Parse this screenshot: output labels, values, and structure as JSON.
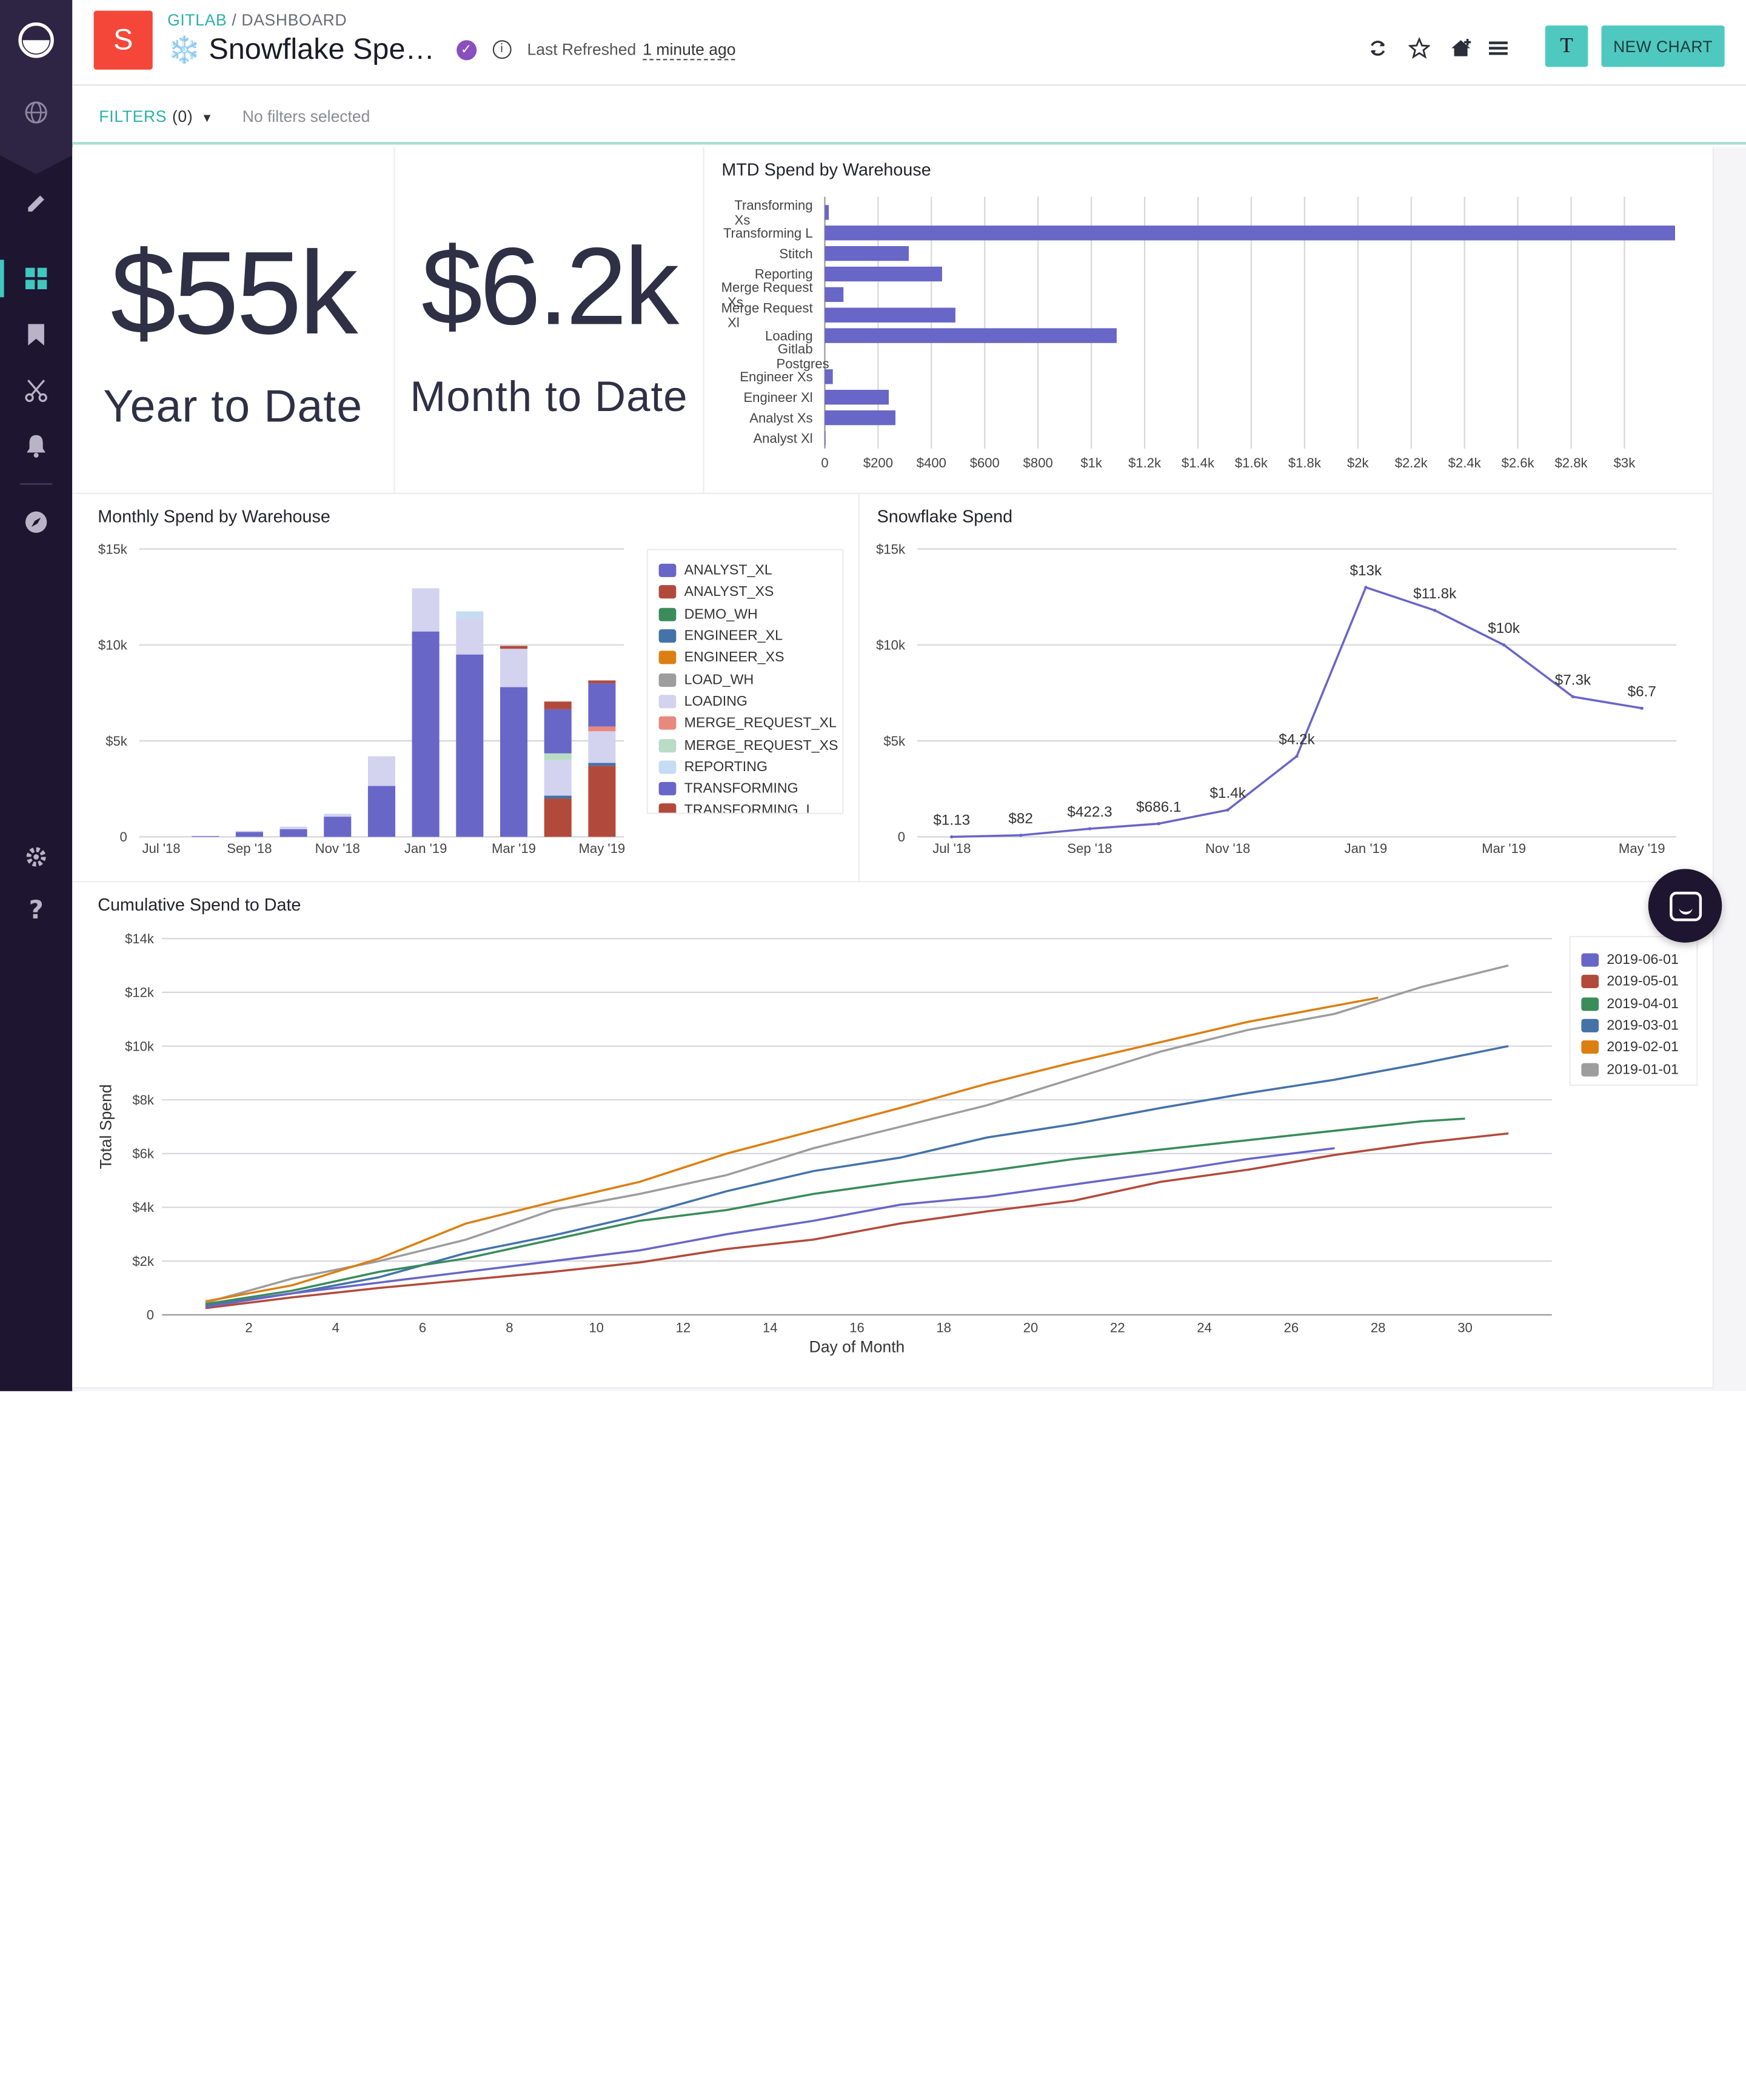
{
  "app": {
    "badge_letter": "S",
    "breadcrumb_org": "GITLAB",
    "breadcrumb_sep": " / ",
    "breadcrumb_page": "DASHBOARD",
    "title_emoji": "❄️",
    "title": "Snowflake Spe…",
    "refreshed_label": "Last Refreshed",
    "refreshed_value": "1 minute ago",
    "user_initial": "T",
    "new_chart_label": "NEW CHART"
  },
  "filters": {
    "label": "FILTERS",
    "count": "(0)",
    "empty_text": "No filters selected"
  },
  "colors": {
    "accent": "#4fc9c0",
    "sidebar": "#1e1530",
    "primary_series": "#6866c7"
  },
  "sidebar_icons": [
    "logo-icon",
    "globe-icon",
    "pencil-icon",
    "dashboard-icon",
    "bookmark-icon",
    "scissors-icon",
    "bell-icon",
    "compass-icon",
    "gear-icon",
    "help-icon"
  ],
  "kpis": [
    {
      "value": "$55k",
      "label": "Year to Date"
    },
    {
      "value": "$6.2k",
      "label": "Month to Date"
    }
  ],
  "charts": {
    "mtd": {
      "title": "MTD Spend by Warehouse",
      "type": "hbar",
      "categories": [
        "Transforming Xs",
        "Transforming L",
        "Stitch",
        "Reporting",
        "Merge Request Xs",
        "Merge Request Xl",
        "Loading",
        "Gitlab Postgres",
        "Engineer Xs",
        "Engineer Xl",
        "Analyst Xs",
        "Analyst Xl"
      ],
      "values": [
        15,
        3190,
        315,
        440,
        70,
        490,
        1095,
        0,
        30,
        240,
        265,
        3
      ],
      "xlim": [
        0,
        3200
      ],
      "ticks": [
        0,
        200,
        400,
        600,
        800,
        1000,
        1200,
        1400,
        1600,
        1800,
        2000,
        2200,
        2400,
        2600,
        2800,
        3000
      ],
      "tick_labels": [
        "0",
        "$200",
        "$400",
        "$600",
        "$800",
        "$1k",
        "$1.2k",
        "$1.4k",
        "$1.6k",
        "$1.8k",
        "$2k",
        "$2.2k",
        "$2.4k",
        "$2.6k",
        "$2.8k",
        "$3k"
      ]
    },
    "monthly": {
      "title": "Monthly Spend by Warehouse",
      "type": "stacked-bar",
      "categories": [
        "2018-07",
        "2018-08",
        "2018-09",
        "2018-10",
        "2018-11",
        "2018-12",
        "2019-01",
        "2019-02",
        "2019-03",
        "2019-04",
        "2019-05"
      ],
      "x_tick_labels": [
        {
          "label": "Jul '18",
          "at": 0
        },
        {
          "label": "Sep '18",
          "at": 2
        },
        {
          "label": "Nov '18",
          "at": 4
        },
        {
          "label": "Jan '19",
          "at": 6
        },
        {
          "label": "Mar '19",
          "at": 8
        },
        {
          "label": "May '19",
          "at": 10
        }
      ],
      "ylim": [
        0,
        15000
      ],
      "y_ticks": [
        0,
        5000,
        10000,
        15000
      ],
      "y_tick_labels": [
        "0",
        "$5k",
        "$10k",
        "$15k"
      ],
      "series": [
        {
          "name": "ANALYST_XL",
          "color": "#6866c7",
          "values": [
            0,
            40,
            250,
            400,
            1050,
            2650,
            10700,
            9500,
            7800,
            0,
            0
          ]
        },
        {
          "name": "ANALYST_XS",
          "color": "#b24a3b",
          "values": [
            0,
            0,
            0,
            0,
            0,
            0,
            0,
            0,
            0,
            2000,
            3700
          ]
        },
        {
          "name": "DEMO_WH",
          "color": "#3a8c5b",
          "values": [
            0,
            0,
            0,
            0,
            0,
            0,
            0,
            0,
            0,
            0,
            0
          ]
        },
        {
          "name": "ENGINEER_XL",
          "color": "#4473a8",
          "values": [
            0,
            0,
            0,
            0,
            0,
            0,
            0,
            0,
            0,
            150,
            150
          ]
        },
        {
          "name": "ENGINEER_XS",
          "color": "#dc7f12",
          "values": [
            0,
            0,
            0,
            0,
            0,
            0,
            0,
            0,
            0,
            0,
            0
          ]
        },
        {
          "name": "LOAD_WH",
          "color": "#9d9d9d",
          "values": [
            0,
            0,
            0,
            0,
            0,
            0,
            0,
            0,
            0,
            0,
            0
          ]
        },
        {
          "name": "LOADING",
          "color": "#d3d2ef",
          "values": [
            0,
            10,
            60,
            130,
            150,
            1550,
            2250,
            1850,
            2000,
            1850,
            1650
          ]
        },
        {
          "name": "MERGE_REQUEST_XL",
          "color": "#e8897e",
          "values": [
            0,
            0,
            0,
            0,
            0,
            0,
            0,
            0,
            0,
            0,
            250
          ]
        },
        {
          "name": "MERGE_REQUEST_XS",
          "color": "#b8dcc6",
          "values": [
            0,
            0,
            0,
            0,
            0,
            0,
            0,
            0,
            0,
            350,
            0
          ]
        },
        {
          "name": "REPORTING",
          "color": "#c6dcf2",
          "values": [
            0,
            0,
            0,
            0,
            0,
            0,
            0,
            400,
            0,
            0,
            0
          ]
        },
        {
          "name": "TRANSFORMING",
          "color": "#6866c7",
          "values": [
            0,
            0,
            0,
            0,
            0,
            0,
            0,
            0,
            0,
            2300,
            2250
          ]
        },
        {
          "name": "TRANSFORMING_L",
          "color": "#b24a3b",
          "values": [
            0,
            0,
            0,
            0,
            0,
            0,
            0,
            0,
            150,
            400,
            150
          ]
        }
      ]
    },
    "snowflake": {
      "title": "Snowflake Spend",
      "type": "line",
      "x": [
        "2018-07",
        "2018-08",
        "2018-09",
        "2018-10",
        "2018-11",
        "2018-12",
        "2019-01",
        "2019-02",
        "2019-03",
        "2019-04",
        "2019-05"
      ],
      "values": [
        1.13,
        82,
        422.3,
        686.1,
        1400,
        4200,
        13000,
        11800,
        10000,
        7300,
        6700
      ],
      "point_labels": [
        "$1.13",
        "$82",
        "$422.3",
        "$686.1",
        "$1.4k",
        "$4.2k",
        "$13k",
        "$11.8k",
        "$10k",
        "$7.3k",
        "$6.7"
      ],
      "x_tick_labels": [
        {
          "label": "Jul '18",
          "at": 0
        },
        {
          "label": "Sep '18",
          "at": 2
        },
        {
          "label": "Nov '18",
          "at": 4
        },
        {
          "label": "Jan '19",
          "at": 6
        },
        {
          "label": "Mar '19",
          "at": 8
        },
        {
          "label": "May '19",
          "at": 10
        }
      ],
      "ylim": [
        0,
        15000
      ],
      "y_ticks": [
        0,
        5000,
        10000,
        15000
      ],
      "y_tick_labels": [
        "0",
        "$5k",
        "$10k",
        "$15k"
      ]
    },
    "cumulative": {
      "title": "Cumulative Spend to Date",
      "type": "line",
      "xlabel": "Day of Month",
      "ylabel": "Total Spend",
      "xlim": [
        0,
        32
      ],
      "x_ticks": [
        2,
        4,
        6,
        8,
        10,
        12,
        14,
        16,
        18,
        20,
        22,
        24,
        26,
        28,
        30
      ],
      "ylim": [
        0,
        14000
      ],
      "y_ticks": [
        0,
        2000,
        4000,
        6000,
        8000,
        10000,
        12000,
        14000
      ],
      "y_tick_labels": [
        "0",
        "$2k",
        "$4k",
        "$6k",
        "$8k",
        "$10k",
        "$12k",
        "$14k"
      ],
      "series": [
        {
          "name": "2019-06-01",
          "color": "#6866c7",
          "x": [
            1,
            3,
            5,
            7,
            9,
            11,
            13,
            15,
            17,
            19,
            21,
            23,
            25,
            27
          ],
          "values": [
            300,
            800,
            1200,
            1600,
            2000,
            2400,
            3000,
            3500,
            4100,
            4400,
            4850,
            5300,
            5800,
            6200
          ]
        },
        {
          "name": "2019-05-01",
          "color": "#b24a3b",
          "x": [
            1,
            3,
            5,
            7,
            9,
            11,
            13,
            15,
            17,
            19,
            21,
            23,
            25,
            27,
            29,
            31
          ],
          "values": [
            250,
            650,
            1000,
            1300,
            1600,
            1950,
            2450,
            2800,
            3400,
            3850,
            4250,
            4950,
            5400,
            5950,
            6400,
            6750
          ]
        },
        {
          "name": "2019-04-01",
          "color": "#3a8c5b",
          "x": [
            1,
            3,
            5,
            7,
            9,
            11,
            13,
            15,
            17,
            19,
            21,
            23,
            25,
            27,
            29,
            30
          ],
          "values": [
            400,
            900,
            1600,
            2100,
            2800,
            3500,
            3900,
            4500,
            4950,
            5350,
            5800,
            6150,
            6500,
            6850,
            7200,
            7300
          ]
        },
        {
          "name": "2019-03-01",
          "color": "#4473a8",
          "x": [
            1,
            3,
            5,
            7,
            9,
            11,
            13,
            15,
            17,
            19,
            21,
            23,
            25,
            27,
            29,
            31
          ],
          "values": [
            350,
            800,
            1400,
            2300,
            2950,
            3700,
            4600,
            5350,
            5850,
            6600,
            7100,
            7700,
            8250,
            8750,
            9350,
            10000
          ]
        },
        {
          "name": "2019-02-01",
          "color": "#dc7f12",
          "x": [
            1,
            3,
            5,
            7,
            9,
            11,
            13,
            15,
            17,
            19,
            21,
            23,
            25,
            27,
            28
          ],
          "values": [
            500,
            1100,
            2100,
            3400,
            4200,
            4950,
            6000,
            6850,
            7700,
            8600,
            9400,
            10150,
            10900,
            11500,
            11800
          ]
        },
        {
          "name": "2019-01-01",
          "color": "#9d9d9d",
          "x": [
            1,
            3,
            5,
            7,
            9,
            11,
            13,
            15,
            17,
            19,
            21,
            23,
            25,
            27,
            29,
            31
          ],
          "values": [
            450,
            1350,
            2000,
            2800,
            3900,
            4500,
            5200,
            6200,
            7000,
            7800,
            8800,
            9800,
            10600,
            11200,
            12200,
            13000
          ]
        }
      ]
    }
  }
}
